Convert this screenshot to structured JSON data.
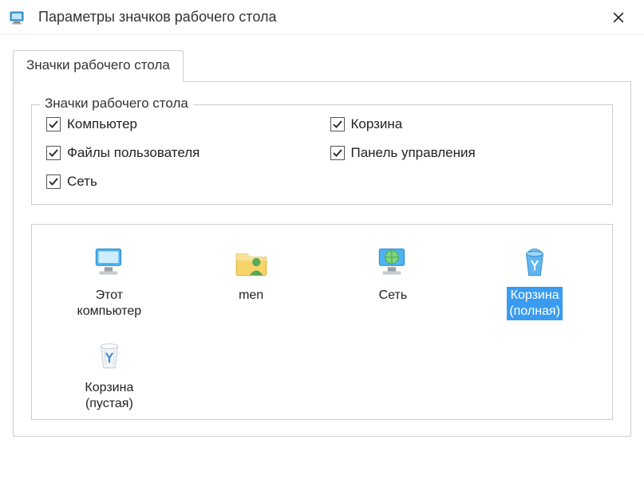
{
  "window": {
    "title": "Параметры значков рабочего стола"
  },
  "tabs": {
    "desktop_icons": "Значки рабочего стола"
  },
  "group": {
    "legend": "Значки рабочего стола",
    "checks": {
      "computer": "Компьютер",
      "recycle": "Корзина",
      "userfiles": "Файлы пользователя",
      "controlpanel": "Панель управления",
      "network": "Сеть"
    }
  },
  "icons": {
    "this_pc": "Этот\nкомпьютер",
    "user": "men",
    "network": "Сеть",
    "recycle_full": "Корзина\n(полная)",
    "recycle_empty": "Корзина\n(пустая)"
  },
  "colors": {
    "selection": "#3a9cf0"
  }
}
